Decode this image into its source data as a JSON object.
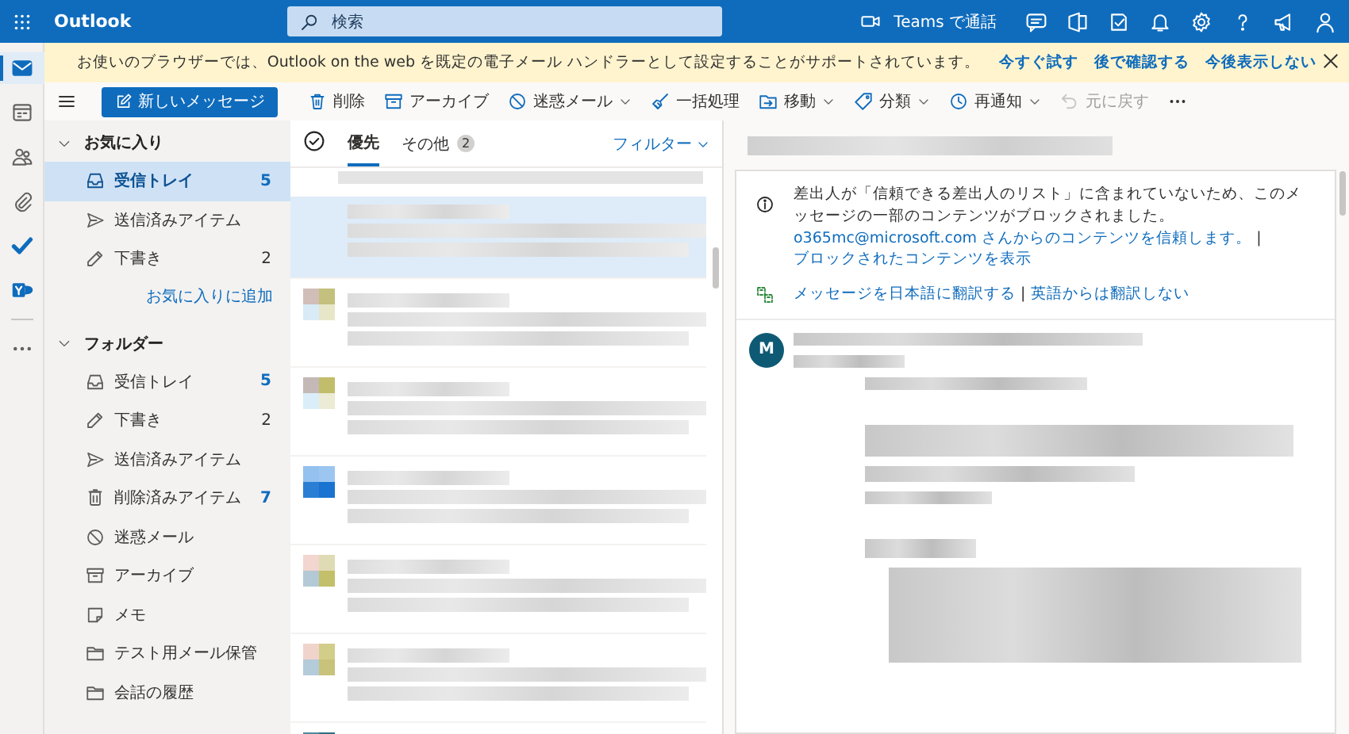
{
  "app": {
    "title": "Outlook"
  },
  "search": {
    "placeholder": "検索"
  },
  "topbar": {
    "teams_label": "Teams で通話"
  },
  "rail": [
    {
      "selected": true
    },
    {
      "selected": false
    },
    {
      "selected": false
    },
    {
      "selected": false
    },
    {
      "selected": false
    },
    {
      "selected": false
    }
  ],
  "notice": {
    "text": "お使いのブラウザーでは、Outlook on the web を既定の電子メール ハンドラーとして設定することがサポートされています。",
    "links": [
      "今すぐ試す",
      "後で確認する",
      "今後表示しない"
    ]
  },
  "toolbar": {
    "new_message": "新しいメッセージ",
    "actions": [
      {
        "label": "削除",
        "dropdown": false,
        "disabled": false
      },
      {
        "label": "アーカイブ",
        "dropdown": false,
        "disabled": false
      },
      {
        "label": "迷惑メール",
        "dropdown": true,
        "disabled": false
      },
      {
        "label": "一括処理",
        "dropdown": false,
        "disabled": false
      },
      {
        "label": "移動",
        "dropdown": true,
        "disabled": false
      },
      {
        "label": "分類",
        "dropdown": true,
        "disabled": false
      },
      {
        "label": "再通知",
        "dropdown": true,
        "disabled": false
      },
      {
        "label": "元に戻す",
        "dropdown": false,
        "disabled": true
      }
    ]
  },
  "folders": {
    "sections": [
      {
        "title": "お気に入り",
        "expanded": true,
        "items": [
          {
            "kind": "inbox",
            "label": "受信トレイ",
            "count": "5",
            "unread": true,
            "selected": true
          },
          {
            "kind": "sent",
            "label": "送信済みアイテム",
            "selected": false
          },
          {
            "kind": "drafts",
            "label": "下書き",
            "count": "2",
            "unread": false,
            "selected": false
          }
        ],
        "add_link": "お気に入りに追加"
      },
      {
        "title": "フォルダー",
        "expanded": true,
        "items": [
          {
            "kind": "inbox",
            "label": "受信トレイ",
            "count": "5",
            "unread": true,
            "selected": false
          },
          {
            "kind": "drafts",
            "label": "下書き",
            "count": "2",
            "unread": false,
            "selected": false
          },
          {
            "kind": "sent",
            "label": "送信済みアイテム",
            "selected": false
          },
          {
            "kind": "deleted",
            "label": "削除済みアイテム",
            "count": "7",
            "unread": true,
            "selected": false
          },
          {
            "kind": "junk",
            "label": "迷惑メール",
            "selected": false
          },
          {
            "kind": "archive",
            "label": "アーカイブ",
            "selected": false
          },
          {
            "kind": "notes",
            "label": "メモ",
            "selected": false
          },
          {
            "kind": "folder",
            "label": "テスト用メール保管",
            "selected": false
          },
          {
            "kind": "folder",
            "label": "会話の履歴",
            "selected": false
          }
        ]
      }
    ]
  },
  "message_list": {
    "tabs": [
      {
        "label": "優先",
        "selected": true
      },
      {
        "label": "その他",
        "count": "2",
        "selected": false
      }
    ],
    "filter": "フィルター",
    "messages": [
      {
        "selected": true
      },
      {
        "selected": false
      },
      {
        "selected": false
      },
      {
        "selected": false
      },
      {
        "selected": false
      },
      {
        "selected": false
      },
      {
        "selected": false
      }
    ]
  },
  "reading_pane": {
    "blocked_notice": {
      "text": "差出人が「信頼できる差出人のリスト」に含まれていないため、このメッセージの一部のコンテンツがブロックされました。",
      "trust_link": "o365mc@microsoft.com さんからのコンテンツを信頼します。",
      "separator": "|",
      "show_link": "ブロックされたコンテンツを表示"
    },
    "translate": {
      "translate_link": "メッセージを日本語に翻訳する",
      "separator": "|",
      "never_link": "英語からは翻訳しない"
    },
    "sender_initial": "M"
  }
}
